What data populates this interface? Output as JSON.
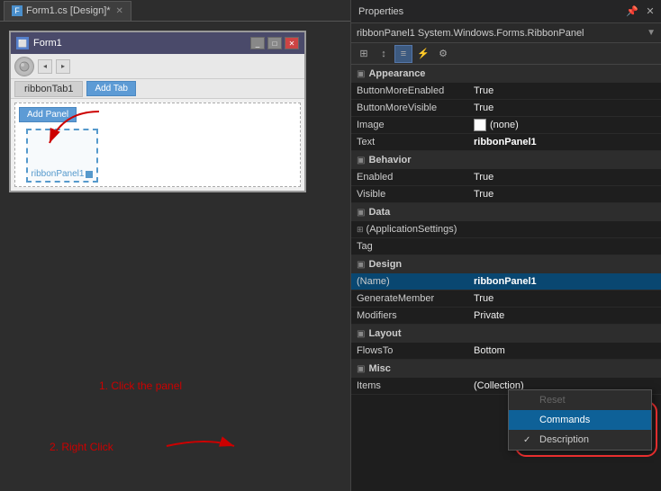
{
  "tabs": [
    {
      "label": "Form1.cs [Design]*",
      "active": true
    }
  ],
  "form": {
    "title": "Form1",
    "ribbon_tab": "ribbonTab1",
    "add_tab_btn": "Add Tab",
    "add_panel_btn": "Add Panel",
    "panel_label": "ribbonPanel1",
    "click_instruction": "1. Click the panel"
  },
  "right_click_label": "2. Right Click",
  "properties": {
    "title": "Properties",
    "object": "ribbonPanel1  System.Windows.Forms.RibbonPanel",
    "sections": [
      {
        "name": "Appearance",
        "rows": [
          {
            "name": "ButtonMoreEnabled",
            "value": "True"
          },
          {
            "name": "ButtonMoreVisible",
            "value": "True"
          },
          {
            "name": "Image",
            "value": "(none)",
            "has_swatch": true
          },
          {
            "name": "Text",
            "value": "ribbonPanel1",
            "bold": true
          }
        ]
      },
      {
        "name": "Behavior",
        "rows": [
          {
            "name": "Enabled",
            "value": "True"
          },
          {
            "name": "Visible",
            "value": "True"
          }
        ]
      },
      {
        "name": "Data",
        "rows": [
          {
            "name": "(ApplicationSettings)",
            "value": ""
          },
          {
            "name": "Tag",
            "value": ""
          }
        ]
      },
      {
        "name": "Design",
        "rows": [
          {
            "name": "(Name)",
            "value": "ribbonPanel1",
            "bold": true,
            "selected": true
          },
          {
            "name": "GenerateMember",
            "value": "True"
          },
          {
            "name": "Modifiers",
            "value": "Private"
          }
        ]
      },
      {
        "name": "Layout",
        "rows": [
          {
            "name": "FlowsTo",
            "value": "Bottom"
          }
        ]
      },
      {
        "name": "Misc",
        "rows": [
          {
            "name": "Items",
            "value": "(Collection)"
          }
        ]
      }
    ]
  },
  "context_menu": {
    "items": [
      {
        "label": "Reset",
        "disabled": true,
        "checked": false
      },
      {
        "label": "Commands",
        "disabled": false,
        "checked": false,
        "highlighted": true
      },
      {
        "label": "Description",
        "disabled": false,
        "checked": true
      }
    ]
  }
}
